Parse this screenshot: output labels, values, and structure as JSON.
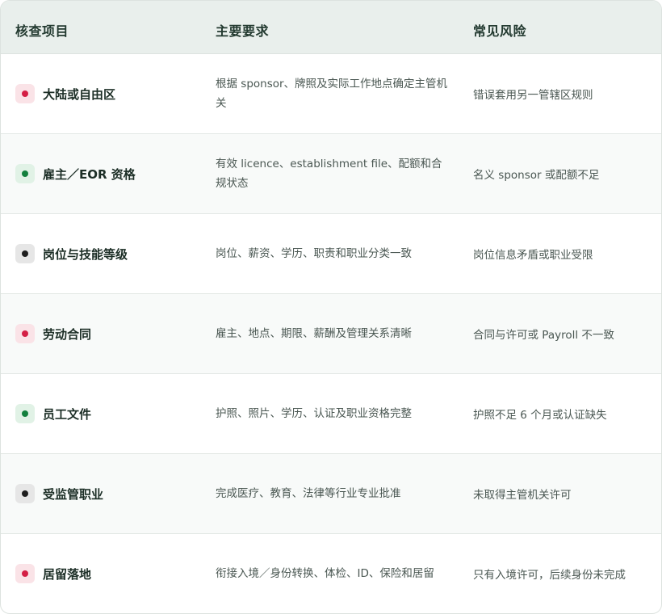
{
  "header": {
    "col_item": "核查项目",
    "col_requirement": "主要要求",
    "col_risk": "常见风险"
  },
  "colors": {
    "red_dot": "#d41f45",
    "red_badge": "#fae3e7",
    "green_dot": "#12803d",
    "green_badge": "#e1f2e6",
    "black_dot": "#1e1e1e",
    "gray_badge": "#e6e6e6"
  },
  "rows": [
    {
      "status": "red",
      "item": "大陆或自由区",
      "requirement": "根据 sponsor、牌照及实际工作地点确定主管机关",
      "risk": "错误套用另一管辖区规则"
    },
    {
      "status": "green",
      "item": "雇主／EOR 资格",
      "requirement": "有效 licence、establishment file、配额和合规状态",
      "risk": "名义 sponsor 或配额不足"
    },
    {
      "status": "black",
      "item": "岗位与技能等级",
      "requirement": "岗位、薪资、学历、职责和职业分类一致",
      "risk": "岗位信息矛盾或职业受限"
    },
    {
      "status": "red",
      "item": "劳动合同",
      "requirement": "雇主、地点、期限、薪酬及管理关系清晰",
      "risk": "合同与许可或 Payroll 不一致"
    },
    {
      "status": "green",
      "item": "员工文件",
      "requirement": "护照、照片、学历、认证及职业资格完整",
      "risk": "护照不足 6 个月或认证缺失"
    },
    {
      "status": "black",
      "item": "受监管职业",
      "requirement": "完成医疗、教育、法律等行业专业批准",
      "risk": "未取得主管机关许可"
    },
    {
      "status": "red",
      "item": "居留落地",
      "requirement": "衔接入境／身份转换、体检、ID、保险和居留",
      "risk": "只有入境许可，后续身份未完成"
    }
  ]
}
